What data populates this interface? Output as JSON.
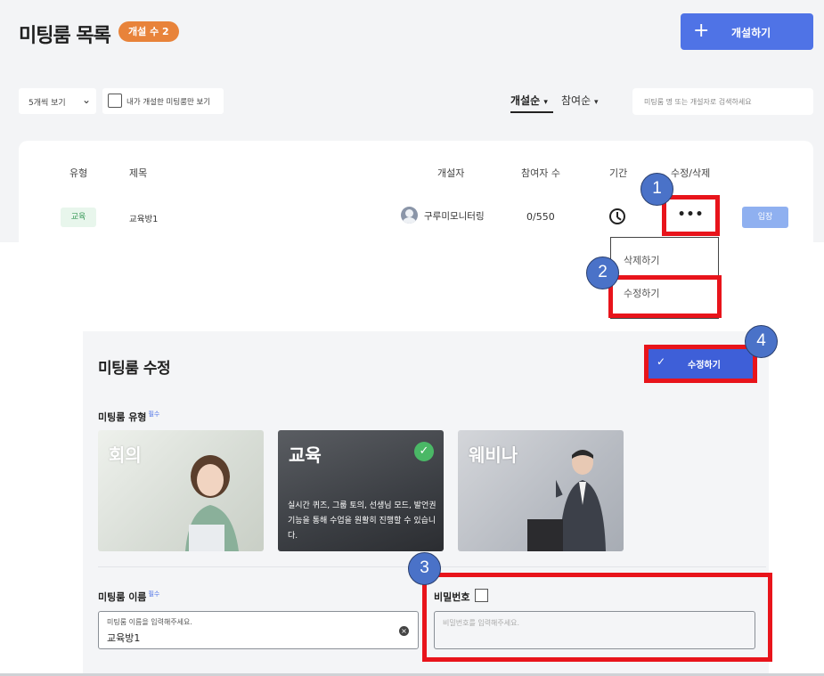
{
  "header": {
    "title": "미팅룸 목록",
    "count_badge": "개설 수 2",
    "create_button": "개설하기"
  },
  "filters": {
    "page_size": "5개씩 보기",
    "mine_only": "내가 개설한 미팅룸만 보기",
    "sort_created": "개설순",
    "sort_participants": "참여순",
    "search_placeholder": "미팅룸 명 또는 개설자로 검색하세요"
  },
  "table": {
    "columns": [
      "유형",
      "제목",
      "개설자",
      "참여자 수",
      "기간",
      "수정/삭제"
    ],
    "row": {
      "type": "교육",
      "title": "교육방1",
      "creator": "구루미모니터링",
      "participants": "0/550",
      "more": "•••",
      "enter": "입장"
    }
  },
  "dropdown": {
    "delete": "삭제하기",
    "edit": "수정하기"
  },
  "edit_panel": {
    "title": "미팅룸 수정",
    "save_button": "수정하기",
    "type_label": "미팅룸 유형",
    "required_tag": "필수",
    "types": [
      {
        "name": "회의"
      },
      {
        "name": "교육",
        "description": "실시간 퀴즈, 그룹 토의, 선생님 모드, 발언권 기능을 통해 수업을 원활히 진행할 수 있습니다."
      },
      {
        "name": "웨비나"
      }
    ],
    "selected_type": "교육",
    "name_label": "미팅룸 이름",
    "name_placeholder": "미팅룸 이름을 입력해주세요.",
    "name_value": "교육방1",
    "password_label": "비밀번호",
    "password_placeholder": "비밀번호를 입력해주세요."
  },
  "steps": [
    "1",
    "2",
    "3",
    "4"
  ],
  "colors": {
    "accent": "#4f73e6",
    "badge": "#e8833a",
    "highlight": "#e8141b",
    "step_circle": "#4a72c8",
    "selected": "#4ab866"
  }
}
